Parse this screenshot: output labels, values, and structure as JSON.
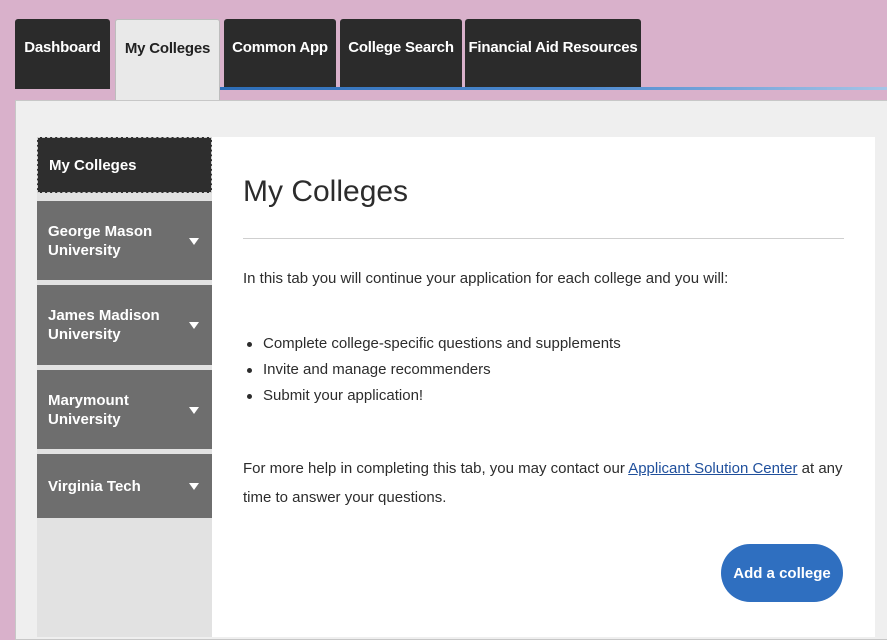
{
  "tabs": [
    {
      "label": "Dashboard",
      "active": false
    },
    {
      "label": "My Colleges",
      "active": true
    },
    {
      "label": "Common App",
      "active": false
    },
    {
      "label": "College Search",
      "active": false
    },
    {
      "label": "Financial Aid Resources",
      "active": false
    }
  ],
  "sidebar": {
    "items": [
      {
        "label": "My Colleges",
        "active": true
      },
      {
        "label": "George Mason University",
        "expandable": true
      },
      {
        "label": "James Madison University",
        "expandable": true
      },
      {
        "label": "Marymount University",
        "expandable": true
      },
      {
        "label": "Virginia Tech",
        "expandable": true
      }
    ]
  },
  "main": {
    "title": "My Colleges",
    "intro": "In this tab you will continue your application for each college and you will:",
    "bullets": [
      "Complete college-specific questions and supplements",
      "Invite and manage recommenders",
      "Submit your application!"
    ],
    "help_prefix": "For more help in completing this tab, you may contact our ",
    "help_link": "Applicant Solution Center",
    "help_suffix": " at any time to answer your questions.",
    "add_button": "Add a college"
  },
  "colors": {
    "background": "#d9b1cb",
    "tab_dark": "#2b2b2b",
    "sidebar_item": "#6e6e6e",
    "accent": "#2f6fc0",
    "link": "#1f4f9c"
  }
}
